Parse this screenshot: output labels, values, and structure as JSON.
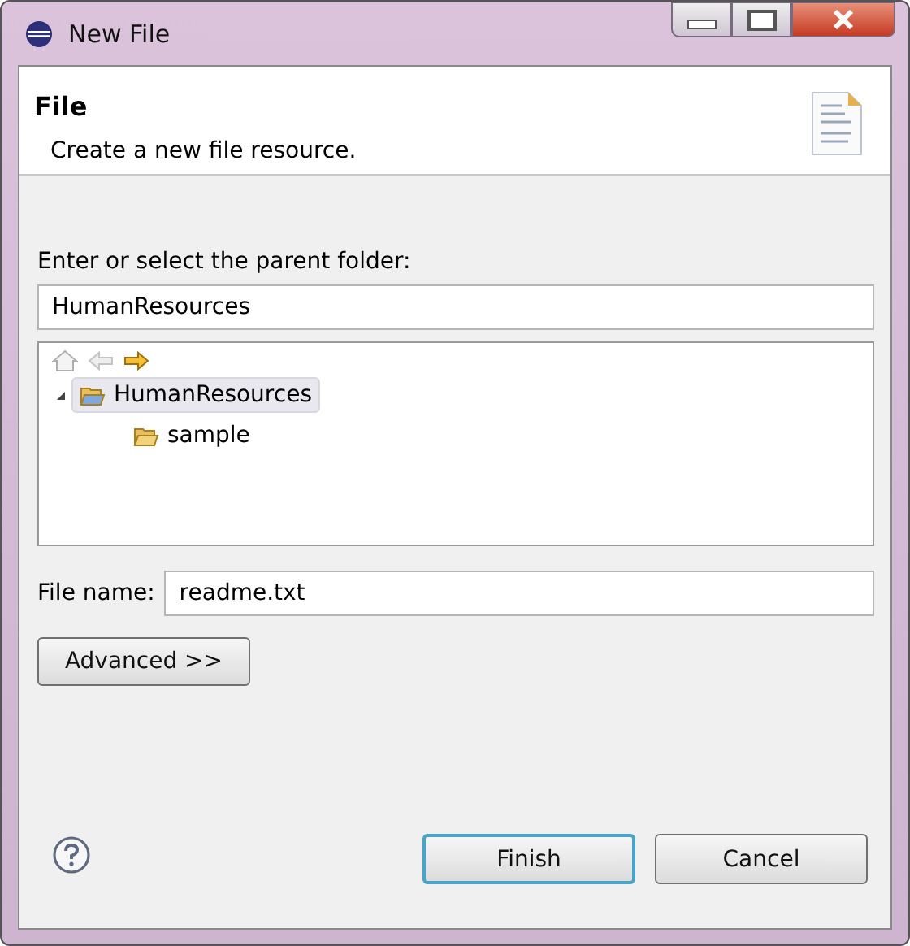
{
  "window": {
    "title": "New File"
  },
  "header": {
    "title": "File",
    "description": "Create a new file resource."
  },
  "parent_folder": {
    "label": "Enter or select the parent folder:",
    "value": "HumanResources"
  },
  "navigation": [
    {
      "kind": "home",
      "disabled": true
    },
    {
      "kind": "back",
      "disabled": true
    },
    {
      "kind": "forward",
      "disabled": false
    }
  ],
  "tree": {
    "items": [
      {
        "label": "HumanResources",
        "selected": true,
        "expanded": true,
        "children": [
          {
            "label": "sample",
            "selected": false
          }
        ]
      }
    ]
  },
  "file_name": {
    "label": "File name:",
    "value": "readme.txt"
  },
  "advanced_button": "Advanced >>",
  "buttons": [
    {
      "label": "Finish",
      "default": true
    },
    {
      "label": "Cancel",
      "default": false
    }
  ]
}
